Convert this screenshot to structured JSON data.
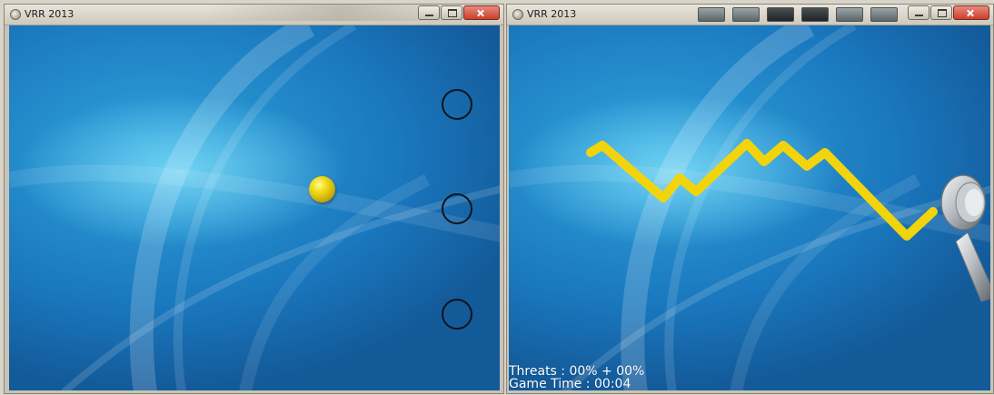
{
  "left_window": {
    "title": "VRR 2013",
    "targets": [
      "target-top",
      "target-middle",
      "target-bottom"
    ]
  },
  "right_window": {
    "title": "VRR 2013",
    "hud": {
      "threats": "Threats : 00% + 00%",
      "game_time": "Game Time : 00:04"
    }
  },
  "colors": {
    "sky_blue": "#1a77bd",
    "trace_yellow": "#f2d40c",
    "ball_yellow": "#f3e01a",
    "ring": "#101418"
  },
  "icons": [
    "app-icon",
    "minimize-icon",
    "maximize-icon",
    "close-icon"
  ]
}
